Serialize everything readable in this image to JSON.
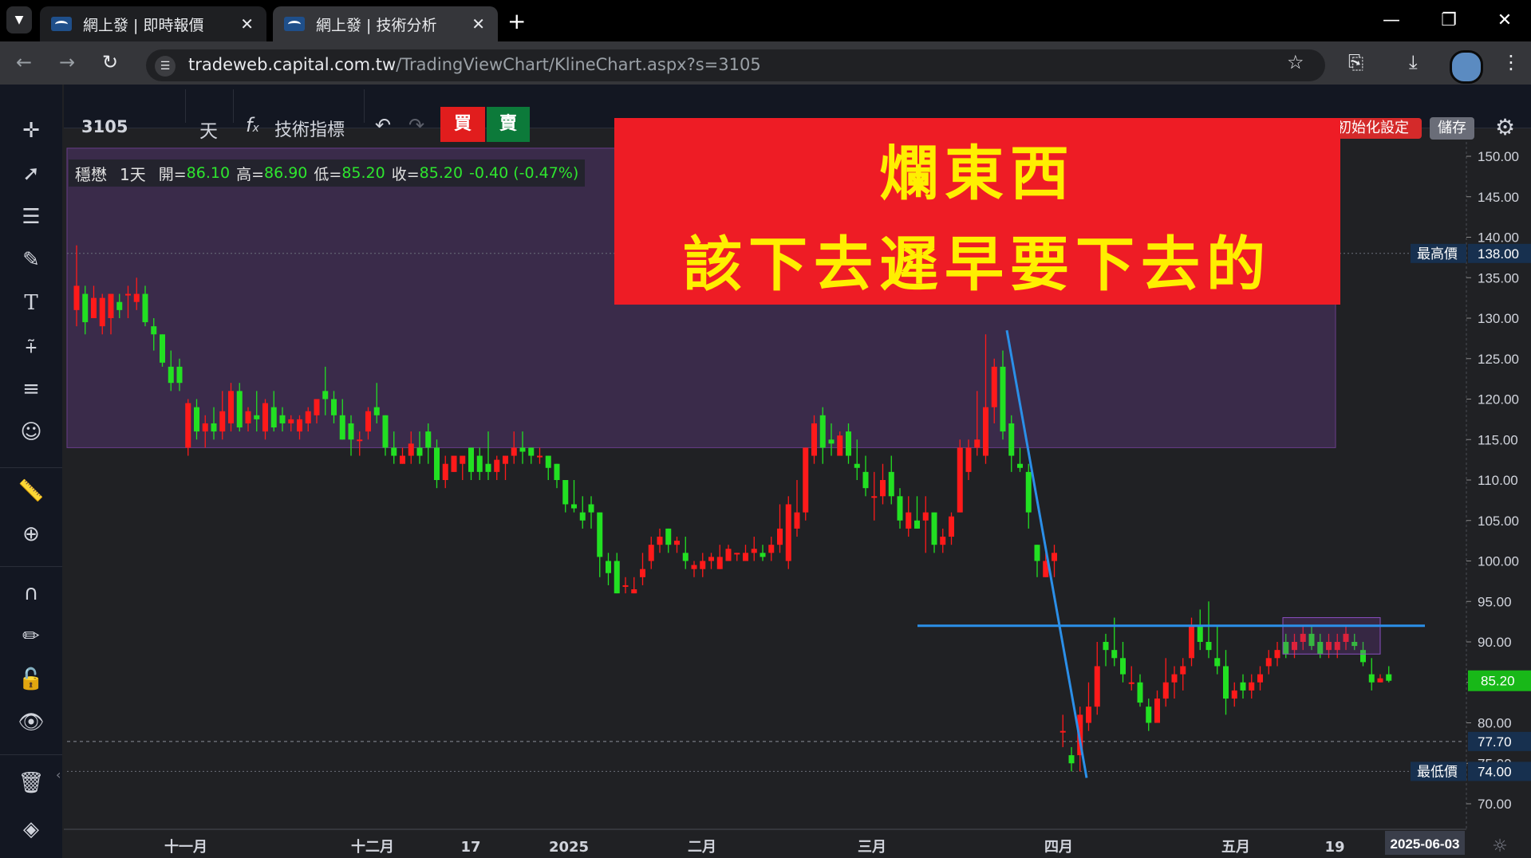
{
  "browser": {
    "tabs": [
      {
        "title": "網上發 | 即時報價"
      },
      {
        "title": "網上發 | 技術分析"
      }
    ],
    "url_host": "tradeweb.capital.com.tw",
    "url_path": "/TradingViewChart/KlineChart.aspx?s=3105"
  },
  "toolbar": {
    "symbol": "3105",
    "interval": "天",
    "indicators_label": "技術指標",
    "buy_label": "買",
    "sell_label": "賣",
    "reset_label": "初始化設定",
    "save_label": "儲存"
  },
  "legend": {
    "name": "穩懋",
    "interval": "1天",
    "open_label": "開=",
    "open": "86.10",
    "high_label": "高=",
    "high": "86.90",
    "low_label": "低=",
    "low": "85.20",
    "close_label": "收=",
    "close": "85.20",
    "change": "-0.40 (-0.47%)"
  },
  "banner": {
    "line1": "爛東西",
    "line2": "該下去遲早要下去的"
  },
  "colors": {
    "up": "#ff1a1a",
    "down": "#22e022",
    "zone": "#3a2b4a",
    "trendline": "#2b8fe8",
    "banner_bg": "#ee1c25",
    "banner_text": "#ffef00"
  },
  "chart_data": {
    "type": "candlestick",
    "y_range": [
      67,
      152
    ],
    "y_ticks": [
      "150.00",
      "145.00",
      "140.00",
      "135.00",
      "130.00",
      "125.00",
      "120.00",
      "115.00",
      "110.00",
      "105.00",
      "100.00",
      "95.00",
      "90.00",
      "85.00",
      "80.00",
      "75.00",
      "70.00"
    ],
    "x_labels": [
      "十一月",
      "十二月",
      "17",
      "2025",
      "二月",
      "三月",
      "四月",
      "五月",
      "19"
    ],
    "price_tags": {
      "high_label": "最高價",
      "high_value": "138.00",
      "low_label": "最低價",
      "low_value": "74.00",
      "last_value": "85.20",
      "ref_value": "77.70"
    },
    "crosshair_date": "2025-06-03",
    "candles": [
      {
        "o": 131,
        "h": 139,
        "l": 129,
        "c": 134
      },
      {
        "o": 133,
        "h": 134,
        "l": 128,
        "c": 129.5
      },
      {
        "o": 130,
        "h": 134,
        "l": 130,
        "c": 132.5
      },
      {
        "o": 129,
        "h": 133,
        "l": 128,
        "c": 132.5
      },
      {
        "o": 130,
        "h": 133,
        "l": 128,
        "c": 133
      },
      {
        "o": 132,
        "h": 133,
        "l": 130,
        "c": 131
      },
      {
        "o": 133,
        "h": 134,
        "l": 130,
        "c": 133
      },
      {
        "o": 132,
        "h": 135,
        "l": 131,
        "c": 133
      },
      {
        "o": 133,
        "h": 134,
        "l": 129,
        "c": 129.5
      },
      {
        "o": 129,
        "h": 130,
        "l": 126,
        "c": 128
      },
      {
        "o": 128,
        "h": 128,
        "l": 124,
        "c": 124.5
      },
      {
        "o": 124,
        "h": 126,
        "l": 121,
        "c": 122
      },
      {
        "o": 124,
        "h": 125,
        "l": 121,
        "c": 122
      },
      {
        "o": 114,
        "h": 120,
        "l": 113,
        "c": 119.5
      },
      {
        "o": 119,
        "h": 120,
        "l": 115,
        "c": 116
      },
      {
        "o": 116,
        "h": 118,
        "l": 114,
        "c": 117
      },
      {
        "o": 117,
        "h": 119,
        "l": 115,
        "c": 116
      },
      {
        "o": 116,
        "h": 121,
        "l": 115,
        "c": 118.5
      },
      {
        "o": 117,
        "h": 122,
        "l": 116,
        "c": 121
      },
      {
        "o": 121,
        "h": 122,
        "l": 116,
        "c": 116.5
      },
      {
        "o": 117,
        "h": 119,
        "l": 116,
        "c": 118.5
      },
      {
        "o": 118,
        "h": 121,
        "l": 116,
        "c": 117.5
      },
      {
        "o": 116,
        "h": 120,
        "l": 115,
        "c": 119.5
      },
      {
        "o": 119,
        "h": 121,
        "l": 116,
        "c": 116.5
      },
      {
        "o": 118,
        "h": 119,
        "l": 116,
        "c": 117
      },
      {
        "o": 117,
        "h": 118,
        "l": 116,
        "c": 117.5
      },
      {
        "o": 116,
        "h": 118,
        "l": 115,
        "c": 117.5
      },
      {
        "o": 117,
        "h": 119,
        "l": 116,
        "c": 118.5
      },
      {
        "o": 118,
        "h": 120,
        "l": 117,
        "c": 120
      },
      {
        "o": 121,
        "h": 124,
        "l": 118,
        "c": 120
      },
      {
        "o": 120,
        "h": 121,
        "l": 117,
        "c": 118
      },
      {
        "o": 118,
        "h": 120,
        "l": 115,
        "c": 115
      },
      {
        "o": 117,
        "h": 118,
        "l": 113,
        "c": 115
      },
      {
        "o": 115,
        "h": 116,
        "l": 113,
        "c": 115
      },
      {
        "o": 116,
        "h": 119,
        "l": 115,
        "c": 118.5
      },
      {
        "o": 119,
        "h": 122,
        "l": 117,
        "c": 118
      },
      {
        "o": 118,
        "h": 118,
        "l": 113,
        "c": 114
      },
      {
        "o": 114,
        "h": 116,
        "l": 112,
        "c": 113
      },
      {
        "o": 112,
        "h": 114,
        "l": 112,
        "c": 113
      },
      {
        "o": 113,
        "h": 116,
        "l": 112,
        "c": 114.5
      },
      {
        "o": 114,
        "h": 116,
        "l": 112,
        "c": 113
      },
      {
        "o": 116,
        "h": 117,
        "l": 112,
        "c": 114
      },
      {
        "o": 114,
        "h": 115,
        "l": 109,
        "c": 110
      },
      {
        "o": 110,
        "h": 113,
        "l": 109,
        "c": 112
      },
      {
        "o": 111,
        "h": 113,
        "l": 111,
        "c": 113
      },
      {
        "o": 112,
        "h": 113,
        "l": 110,
        "c": 113
      },
      {
        "o": 114,
        "h": 114,
        "l": 110,
        "c": 111
      },
      {
        "o": 113,
        "h": 114,
        "l": 110,
        "c": 111
      },
      {
        "o": 112,
        "h": 116,
        "l": 110,
        "c": 111
      },
      {
        "o": 111,
        "h": 113,
        "l": 110,
        "c": 112.5
      },
      {
        "o": 112,
        "h": 113,
        "l": 110,
        "c": 113
      },
      {
        "o": 113,
        "h": 116,
        "l": 112,
        "c": 114
      },
      {
        "o": 114,
        "h": 116,
        "l": 112,
        "c": 113.5
      },
      {
        "o": 114,
        "h": 114,
        "l": 112,
        "c": 113
      },
      {
        "o": 113,
        "h": 114,
        "l": 112,
        "c": 113
      },
      {
        "o": 113,
        "h": 113,
        "l": 110,
        "c": 111.5
      },
      {
        "o": 112,
        "h": 112,
        "l": 109,
        "c": 110
      },
      {
        "o": 110,
        "h": 110,
        "l": 106,
        "c": 107
      },
      {
        "o": 107,
        "h": 110,
        "l": 106,
        "c": 106.5
      },
      {
        "o": 106,
        "h": 108,
        "l": 104,
        "c": 105
      },
      {
        "o": 107,
        "h": 108,
        "l": 104,
        "c": 106
      },
      {
        "o": 106,
        "h": 106,
        "l": 98,
        "c": 100.5
      },
      {
        "o": 100,
        "h": 101,
        "l": 97,
        "c": 98.5
      },
      {
        "o": 100,
        "h": 101,
        "l": 96,
        "c": 96
      },
      {
        "o": 97,
        "h": 98,
        "l": 96,
        "c": 97
      },
      {
        "o": 96,
        "h": 98,
        "l": 96,
        "c": 96.5
      },
      {
        "o": 98,
        "h": 101,
        "l": 97,
        "c": 99
      },
      {
        "o": 100,
        "h": 103,
        "l": 99,
        "c": 102
      },
      {
        "o": 102,
        "h": 104,
        "l": 101,
        "c": 103
      },
      {
        "o": 104,
        "h": 104,
        "l": 101,
        "c": 102
      },
      {
        "o": 102,
        "h": 103,
        "l": 101,
        "c": 102.5
      },
      {
        "o": 101,
        "h": 103,
        "l": 99,
        "c": 100
      },
      {
        "o": 99,
        "h": 100,
        "l": 98,
        "c": 99.5
      },
      {
        "o": 99,
        "h": 101,
        "l": 98,
        "c": 100
      },
      {
        "o": 100,
        "h": 101,
        "l": 99,
        "c": 100.5
      },
      {
        "o": 99,
        "h": 102,
        "l": 99,
        "c": 100.5
      },
      {
        "o": 100,
        "h": 102,
        "l": 100,
        "c": 101.5
      },
      {
        "o": 101,
        "h": 101,
        "l": 100,
        "c": 101
      },
      {
        "o": 100,
        "h": 102,
        "l": 100,
        "c": 101
      },
      {
        "o": 101,
        "h": 103,
        "l": 100,
        "c": 101.5
      },
      {
        "o": 101,
        "h": 102,
        "l": 100,
        "c": 100.5
      },
      {
        "o": 101,
        "h": 103,
        "l": 100,
        "c": 102
      },
      {
        "o": 102,
        "h": 107,
        "l": 101,
        "c": 104
      },
      {
        "o": 100,
        "h": 108,
        "l": 99,
        "c": 107
      },
      {
        "o": 104,
        "h": 110,
        "l": 103,
        "c": 106
      },
      {
        "o": 106,
        "h": 114,
        "l": 105,
        "c": 114
      },
      {
        "o": 113,
        "h": 118,
        "l": 112,
        "c": 117
      },
      {
        "o": 118,
        "h": 119,
        "l": 112,
        "c": 114
      },
      {
        "o": 115,
        "h": 117,
        "l": 113,
        "c": 114.5
      },
      {
        "o": 113,
        "h": 116,
        "l": 113,
        "c": 115.5
      },
      {
        "o": 116,
        "h": 117,
        "l": 112,
        "c": 113
      },
      {
        "o": 112,
        "h": 115,
        "l": 110,
        "c": 111.5
      },
      {
        "o": 111,
        "h": 113,
        "l": 108,
        "c": 109
      },
      {
        "o": 108,
        "h": 111,
        "l": 105,
        "c": 108
      },
      {
        "o": 108,
        "h": 112,
        "l": 107,
        "c": 110
      },
      {
        "o": 111,
        "h": 113,
        "l": 107,
        "c": 108
      },
      {
        "o": 108,
        "h": 109,
        "l": 104,
        "c": 105
      },
      {
        "o": 104,
        "h": 108,
        "l": 103,
        "c": 106
      },
      {
        "o": 105,
        "h": 108,
        "l": 104,
        "c": 104
      },
      {
        "o": 105,
        "h": 108,
        "l": 101,
        "c": 106
      },
      {
        "o": 106,
        "h": 106,
        "l": 101,
        "c": 102
      },
      {
        "o": 102,
        "h": 104,
        "l": 101,
        "c": 103
      },
      {
        "o": 103,
        "h": 106,
        "l": 102,
        "c": 105.5
      },
      {
        "o": 106,
        "h": 115,
        "l": 106,
        "c": 114
      },
      {
        "o": 111,
        "h": 115,
        "l": 110,
        "c": 114
      },
      {
        "o": 114,
        "h": 121,
        "l": 113,
        "c": 115
      },
      {
        "o": 113,
        "h": 128,
        "l": 112,
        "c": 119
      },
      {
        "o": 119,
        "h": 125,
        "l": 117,
        "c": 124
      },
      {
        "o": 124,
        "h": 126,
        "l": 115,
        "c": 116
      },
      {
        "o": 117,
        "h": 118,
        "l": 111,
        "c": 113
      },
      {
        "o": 112,
        "h": 114,
        "l": 111,
        "c": 111.5
      },
      {
        "o": 111,
        "h": 112,
        "l": 104,
        "c": 106
      },
      {
        "o": 102,
        "h": 102,
        "l": 98,
        "c": 100
      },
      {
        "o": 98,
        "h": 101,
        "l": 98,
        "c": 100
      },
      {
        "o": 100,
        "h": 102,
        "l": 98,
        "c": 101
      },
      {
        "o": 79,
        "h": 81,
        "l": 77,
        "c": 79
      },
      {
        "o": 76,
        "h": 77,
        "l": 74,
        "c": 75
      },
      {
        "o": 76,
        "h": 82,
        "l": 74,
        "c": 81
      },
      {
        "o": 80,
        "h": 85,
        "l": 79,
        "c": 82
      },
      {
        "o": 82,
        "h": 90,
        "l": 81,
        "c": 87
      },
      {
        "o": 90,
        "h": 91,
        "l": 87,
        "c": 89
      },
      {
        "o": 89,
        "h": 93,
        "l": 87,
        "c": 88
      },
      {
        "o": 88,
        "h": 90,
        "l": 85,
        "c": 86
      },
      {
        "o": 85,
        "h": 87,
        "l": 84,
        "c": 85
      },
      {
        "o": 85,
        "h": 86,
        "l": 82,
        "c": 82.5
      },
      {
        "o": 82,
        "h": 83,
        "l": 79,
        "c": 80
      },
      {
        "o": 80,
        "h": 84,
        "l": 80,
        "c": 83
      },
      {
        "o": 83,
        "h": 88,
        "l": 82,
        "c": 85
      },
      {
        "o": 85,
        "h": 87,
        "l": 83,
        "c": 86
      },
      {
        "o": 86,
        "h": 88,
        "l": 84,
        "c": 87
      },
      {
        "o": 88,
        "h": 93,
        "l": 87,
        "c": 92
      },
      {
        "o": 92,
        "h": 94,
        "l": 89,
        "c": 90
      },
      {
        "o": 90,
        "h": 95,
        "l": 88,
        "c": 89
      },
      {
        "o": 88,
        "h": 92,
        "l": 86,
        "c": 87
      },
      {
        "o": 87,
        "h": 89,
        "l": 81,
        "c": 83
      },
      {
        "o": 83,
        "h": 85,
        "l": 82,
        "c": 84
      },
      {
        "o": 85,
        "h": 86,
        "l": 83,
        "c": 84
      },
      {
        "o": 84,
        "h": 86,
        "l": 83,
        "c": 85
      },
      {
        "o": 85,
        "h": 87,
        "l": 84,
        "c": 86
      },
      {
        "o": 87,
        "h": 89,
        "l": 86,
        "c": 88
      },
      {
        "o": 88,
        "h": 90,
        "l": 87,
        "c": 89
      },
      {
        "o": 90,
        "h": 91,
        "l": 88,
        "c": 88.5
      },
      {
        "o": 89,
        "h": 91,
        "l": 88,
        "c": 90
      },
      {
        "o": 90,
        "h": 92,
        "l": 89,
        "c": 91
      },
      {
        "o": 91,
        "h": 92,
        "l": 89,
        "c": 89.5
      },
      {
        "o": 90,
        "h": 91,
        "l": 88,
        "c": 88.5
      },
      {
        "o": 89,
        "h": 91,
        "l": 88,
        "c": 90
      },
      {
        "o": 89,
        "h": 91,
        "l": 88,
        "c": 90
      },
      {
        "o": 90,
        "h": 92,
        "l": 89,
        "c": 91
      },
      {
        "o": 90,
        "h": 91,
        "l": 89,
        "c": 89.5
      },
      {
        "o": 89,
        "h": 90,
        "l": 87,
        "c": 87.5
      },
      {
        "o": 86,
        "h": 88,
        "l": 84,
        "c": 85
      },
      {
        "o": 85,
        "h": 86,
        "l": 85,
        "c": 85.5
      },
      {
        "o": 86,
        "h": 87,
        "l": 85,
        "c": 85.2
      }
    ]
  }
}
